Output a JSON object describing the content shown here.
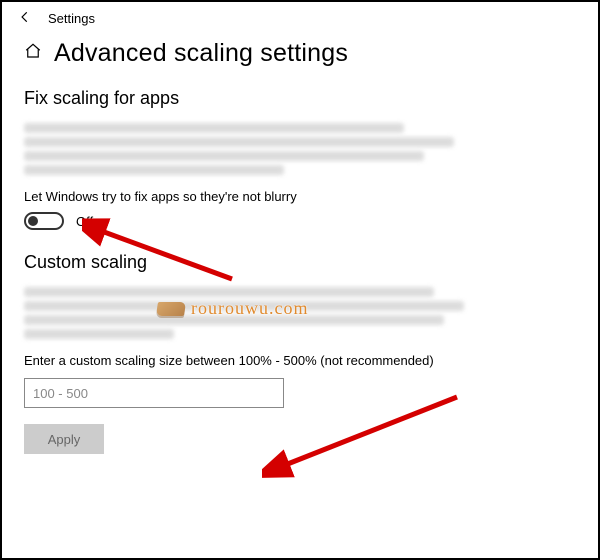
{
  "topbar": {
    "title": "Settings"
  },
  "header": {
    "title": "Advanced scaling settings"
  },
  "fix": {
    "section_title": "Fix scaling for apps",
    "toggle_label": "Let Windows try to fix apps so they're not blurry",
    "toggle_state": "Off"
  },
  "custom": {
    "section_title": "Custom scaling",
    "input_label": "Enter a custom scaling size between 100% - 500% (not recommended)",
    "input_placeholder": "100 - 500",
    "apply_label": "Apply"
  },
  "watermark": {
    "text": "rourouwu.com"
  }
}
